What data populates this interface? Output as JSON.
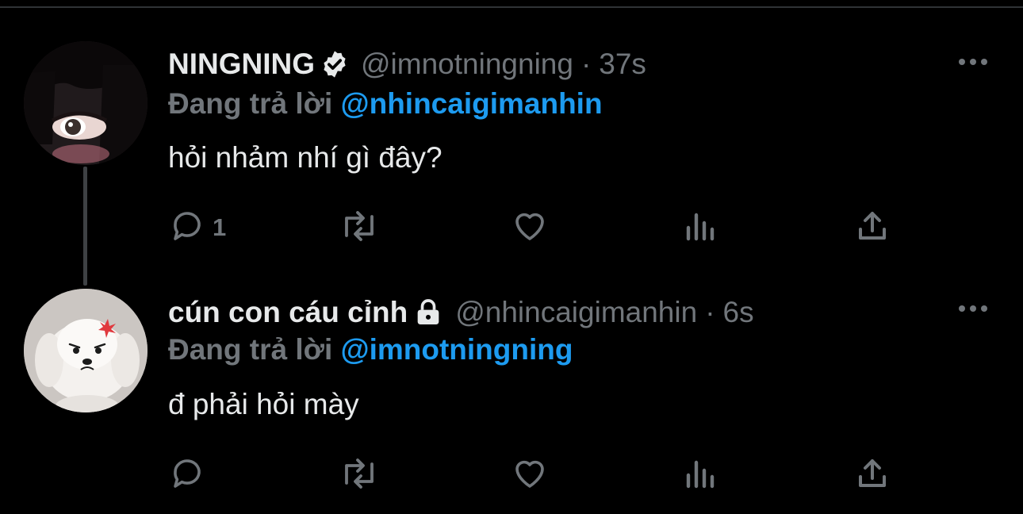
{
  "colors": {
    "background": "#000000",
    "text": "#e7e9ea",
    "muted": "#71767b",
    "accent": "#1d9bf0"
  },
  "tweets": [
    {
      "display_name": "NINGNING",
      "badge": "verified-badge-icon",
      "handle": "@imnotningning",
      "separator": "·",
      "time": "37s",
      "reply_prefix": "Đang trả lời",
      "reply_to": "@nhincaigimanhin",
      "text": "hỏi nhảm nhí gì đây?",
      "reply_count": "1"
    },
    {
      "display_name": "cún con cáu cỉnh",
      "badge": "lock-icon",
      "handle": "@nhincaigimanhin",
      "separator": "·",
      "time": "6s",
      "reply_prefix": "Đang trả lời",
      "reply_to": "@imnotningning",
      "text": "đ phải hỏi mày",
      "reply_count": ""
    }
  ]
}
